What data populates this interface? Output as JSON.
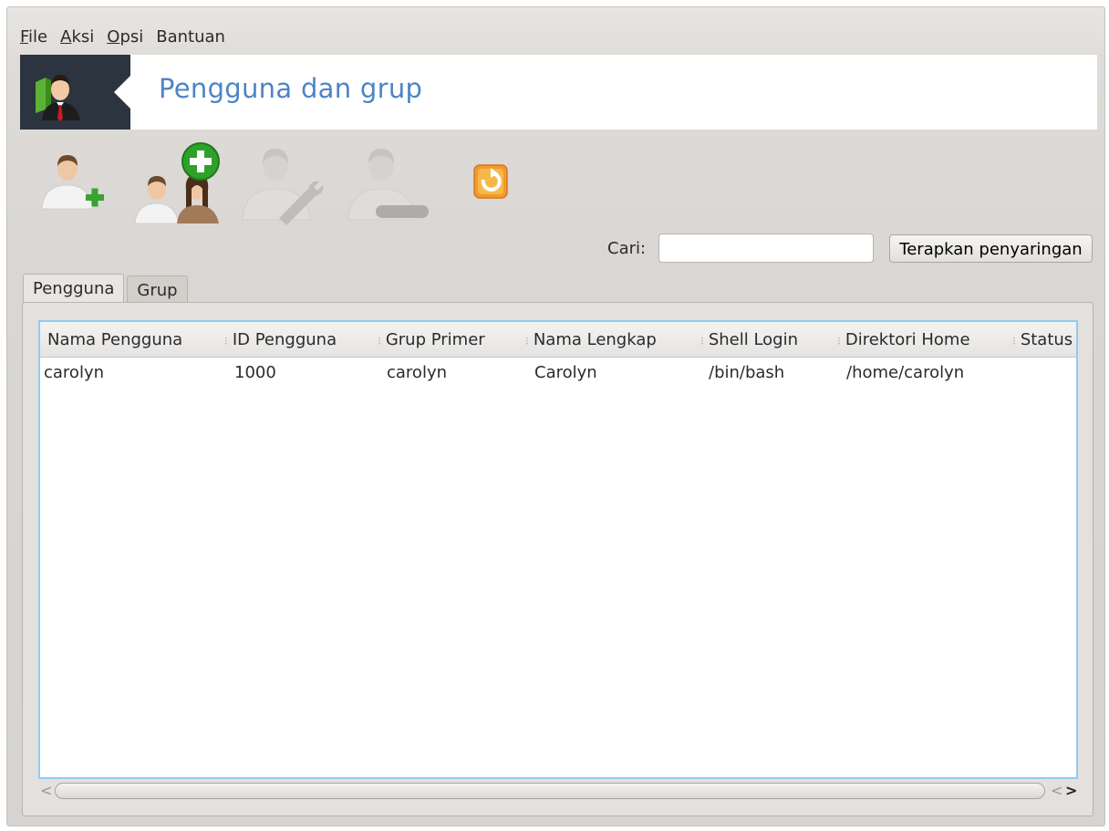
{
  "menu": {
    "file": "File",
    "aksi": "Aksi",
    "opsi": "Opsi",
    "bantuan": "Bantuan"
  },
  "banner": {
    "title": "Pengguna dan grup"
  },
  "toolbar": {
    "buttons": [
      {
        "icon": "add-user-icon",
        "enabled": true
      },
      {
        "icon": "add-group-icon",
        "enabled": true
      },
      {
        "icon": "edit-user-icon",
        "enabled": false
      },
      {
        "icon": "delete-user-icon",
        "enabled": false
      },
      {
        "icon": "refresh-icon",
        "enabled": true
      }
    ]
  },
  "search": {
    "label": "Cari:",
    "value": "",
    "apply_label": "Terapkan penyaringan"
  },
  "tabs": [
    {
      "label": "Pengguna",
      "active": true
    },
    {
      "label": "Grup",
      "active": false
    }
  ],
  "table": {
    "columns": [
      "Nama Pengguna",
      "ID Pengguna",
      "Grup Primer",
      "Nama Lengkap",
      "Shell Login",
      "Direktori Home",
      "Status"
    ],
    "rows": [
      [
        "carolyn",
        "1000",
        "carolyn",
        "Carolyn",
        "/bin/bash",
        "/home/carolyn",
        ""
      ]
    ]
  },
  "colors": {
    "banner_title": "#4e84c6",
    "banner_dark": "#2c3440",
    "table_focus_border": "#8fcdf0",
    "refresh_orange": "#f08a1c"
  }
}
